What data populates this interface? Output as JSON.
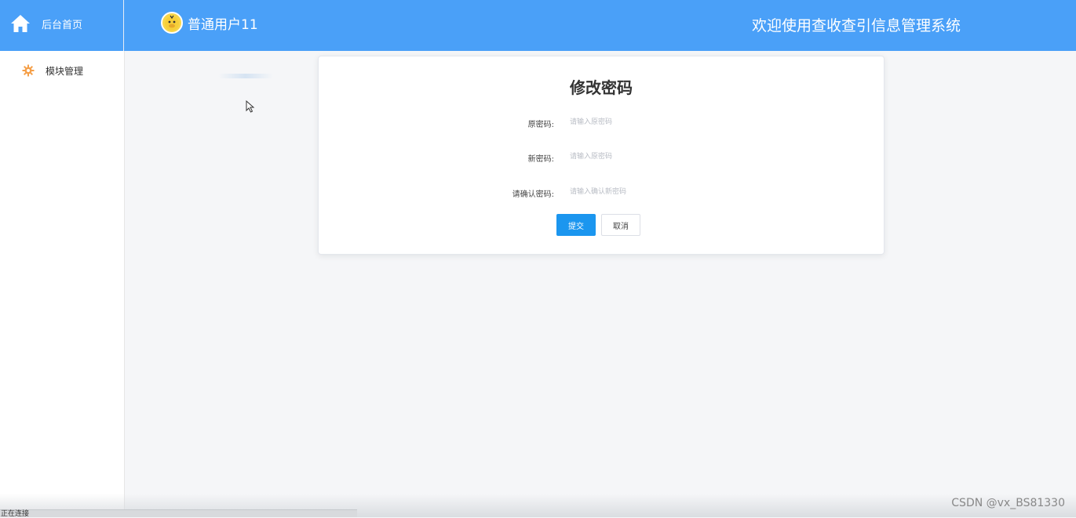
{
  "header": {
    "home_label": "后台首页",
    "username": "普通用户11",
    "system_title": "欢迎使用查收查引信息管理系统",
    "bg_color": "#4aa0f8"
  },
  "sidebar": {
    "items": [
      {
        "label": "模块管理",
        "icon": "gear-icon",
        "icon_color": "#f5a04a"
      }
    ]
  },
  "form": {
    "title": "修改密码",
    "fields": [
      {
        "label": "原密码:",
        "placeholder": "请输入原密码",
        "value": ""
      },
      {
        "label": "新密码:",
        "placeholder": "请输入原密码",
        "value": ""
      },
      {
        "label": "请确认密码:",
        "placeholder": "请输入确认新密码",
        "value": ""
      }
    ],
    "submit_label": "提交",
    "cancel_label": "取消",
    "submit_color": "#1b96ef"
  },
  "status": {
    "text": "正在连接"
  },
  "watermark": "CSDN @vx_BS81330"
}
